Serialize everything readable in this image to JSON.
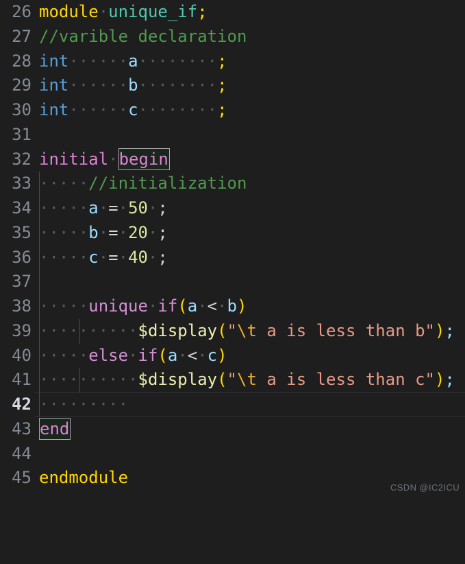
{
  "editor": {
    "language": "verilog",
    "background_color": "#1e1e1e",
    "first_line": 26,
    "active_line": 42,
    "watermark": "CSDN @IC2ICU",
    "colors": {
      "background": "#1e1e1e",
      "line_number": "#848b94",
      "line_number_active": "#d7dae0",
      "keyword_module": "#ffd700",
      "type": "#569cd6",
      "identifier": "#9cdcfe",
      "module_name": "#4ec9b0",
      "comment": "#4f9a4f",
      "control_keyword": "#e07fd5",
      "number": "#d7e8a0",
      "punctuation": "#d4d4d4",
      "paren": "#ffd700",
      "system_task": "#eeeeb0",
      "string": "#e89a87",
      "escape": "#f0a830",
      "indent_guide": "#4a4a4a",
      "bracket_match_border": "#a8a8a8",
      "bracket_match_fill": "#18261c"
    },
    "lines": [
      {
        "number": 26,
        "text": "module unique_if;"
      },
      {
        "number": 27,
        "text": "//varible declaration"
      },
      {
        "number": 28,
        "text": "int      a         ;"
      },
      {
        "number": 29,
        "text": "int      b         ;"
      },
      {
        "number": 30,
        "text": "int      c         ;"
      },
      {
        "number": 31,
        "text": ""
      },
      {
        "number": 32,
        "text": "initial begin"
      },
      {
        "number": 33,
        "text": "     //initialization"
      },
      {
        "number": 34,
        "text": "     a = 50 ;"
      },
      {
        "number": 35,
        "text": "     b = 20 ;"
      },
      {
        "number": 36,
        "text": "     c = 40 ;"
      },
      {
        "number": 37,
        "text": ""
      },
      {
        "number": 38,
        "text": "     unique if(a < b)"
      },
      {
        "number": 39,
        "text": "          $display(\"\\t a is less than b\");"
      },
      {
        "number": 40,
        "text": "     else if(a < c)"
      },
      {
        "number": 41,
        "text": "          $display(\"\\t a is less than c\");"
      },
      {
        "number": 42,
        "text": "         "
      },
      {
        "number": 43,
        "text": "end"
      },
      {
        "number": 44,
        "text": ""
      },
      {
        "number": 45,
        "text": "endmodule"
      }
    ],
    "line_numbers": {
      "n26": "26",
      "n27": "27",
      "n28": "28",
      "n29": "29",
      "n30": "30",
      "n31": "31",
      "n32": "32",
      "n33": "33",
      "n34": "34",
      "n35": "35",
      "n36": "36",
      "n37": "37",
      "n38": "38",
      "n39": "39",
      "n40": "40",
      "n41": "41",
      "n42": "42",
      "n43": "43",
      "n44": "44",
      "n45": "45"
    },
    "tokens": {
      "kw_module": "module",
      "module_name": "unique_if",
      "semi": ";",
      "comment_varible": "//varible declaration",
      "type_int": "int",
      "var_a": "a",
      "var_b": "b",
      "var_c": "c",
      "kw_initial": "initial",
      "kw_begin": "begin",
      "comment_init": "//initialization",
      "op_assign": "=",
      "num_50": "50",
      "num_20": "20",
      "num_40": "40",
      "kw_unique": "unique",
      "kw_if": "if",
      "kw_else": "else",
      "paren_open": "(",
      "paren_close": ")",
      "op_lt": "<",
      "sys_display": "$display",
      "quote": "\"",
      "escape_t": "\\t",
      "str_less_b": " a is less than b",
      "str_less_c": " a is less than c",
      "kw_end": "end",
      "kw_endmodule": "endmodule",
      "ws_dot": "·"
    }
  }
}
